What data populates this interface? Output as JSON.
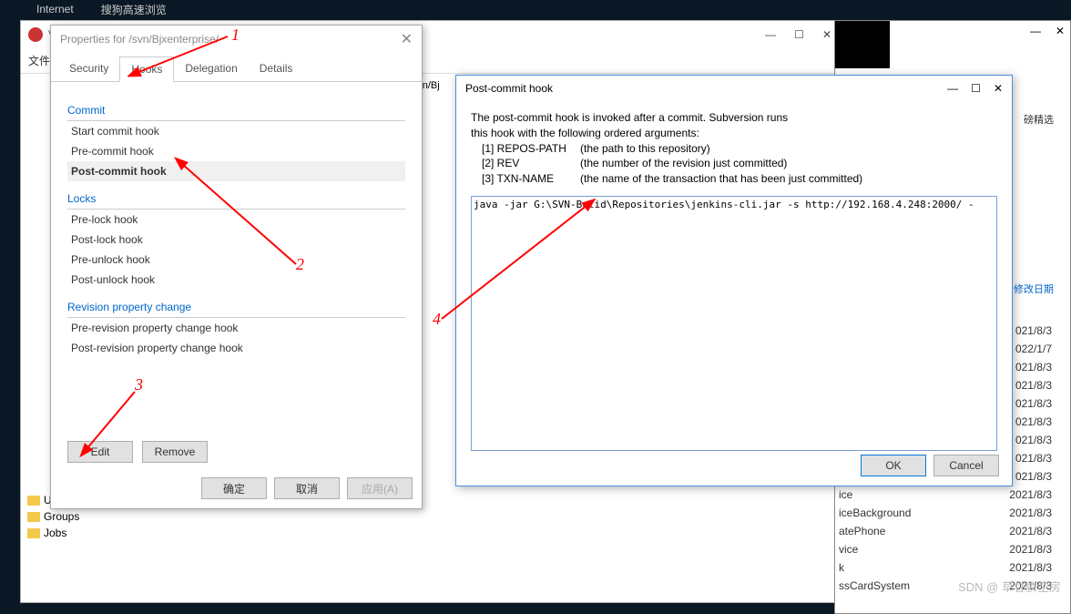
{
  "taskbar": {
    "item1": "Internet",
    "item2": "搜狗高速浏览"
  },
  "svn": {
    "title": "VisualSVN Server",
    "file_label": "文件",
    "path": "r/svn/Bj"
  },
  "props": {
    "title": "Properties for /svn/Bjxenterprise/",
    "tabs": {
      "security": "Security",
      "hooks": "Hooks",
      "delegation": "Delegation",
      "details": "Details"
    },
    "sections": {
      "commit": "Commit",
      "locks": "Locks",
      "revprop": "Revision property change"
    },
    "commit_hooks": {
      "start": "Start commit hook",
      "pre": "Pre-commit hook",
      "post": "Post-commit hook"
    },
    "lock_hooks": {
      "pre_lock": "Pre-lock hook",
      "post_lock": "Post-lock hook",
      "pre_unlock": "Pre-unlock hook",
      "post_unlock": "Post-unlock hook"
    },
    "rev_hooks": {
      "pre": "Pre-revision property change hook",
      "post": "Post-revision property change hook"
    },
    "buttons": {
      "edit": "Edit",
      "remove": "Remove",
      "ok": "确定",
      "cancel": "取消",
      "apply": "应用(A)"
    }
  },
  "hook": {
    "title": "Post-commit hook",
    "desc1": "The post-commit hook is invoked after a commit. Subversion runs",
    "desc2": "this hook with the following ordered arguments:",
    "arg1k": "[1] REPOS-PATH",
    "arg1v": "(the path to this repository)",
    "arg2k": "[2] REV",
    "arg2v": "(the number of the revision just committed)",
    "arg3k": "[3] TXN-NAME",
    "arg3v": "(the name of the transaction that has been just committed)",
    "code": "java -jar G:\\SVN-Bulid\\Repositories\\jenkins-cli.jar -s http://192.168.4.248:2000/ -",
    "ok": "OK",
    "cancel": "Cancel"
  },
  "tree": {
    "users": "Users",
    "groups": "Groups",
    "jobs": "Jobs"
  },
  "files": {
    "header_date": "修改日期",
    "header_featured": "磅精选",
    "rows": [
      {
        "name": "",
        "date": "021/8/3"
      },
      {
        "name": "",
        "date": "022/1/7"
      },
      {
        "name": "",
        "date": "021/8/3"
      },
      {
        "name": "",
        "date": "021/8/3"
      },
      {
        "name": "",
        "date": "021/8/3"
      },
      {
        "name": "",
        "date": "021/8/3"
      },
      {
        "name": "",
        "date": "021/8/3"
      },
      {
        "name": "",
        "date": "021/8/3"
      },
      {
        "name": "",
        "date": "021/8/3"
      },
      {
        "name": "ice",
        "date": "2021/8/3"
      },
      {
        "name": "iceBackground",
        "date": "2021/8/3"
      },
      {
        "name": "atePhone",
        "date": "2021/8/3"
      },
      {
        "name": "vice",
        "date": "2021/8/3"
      },
      {
        "name": "k",
        "date": "2021/8/3"
      },
      {
        "name": "ssCardSystem",
        "date": "2021/8/3"
      }
    ]
  },
  "anno": {
    "a1": "1",
    "a2": "2",
    "a3": "3",
    "a4": "4"
  },
  "watermark": "SDN @ 草甘膦空房"
}
